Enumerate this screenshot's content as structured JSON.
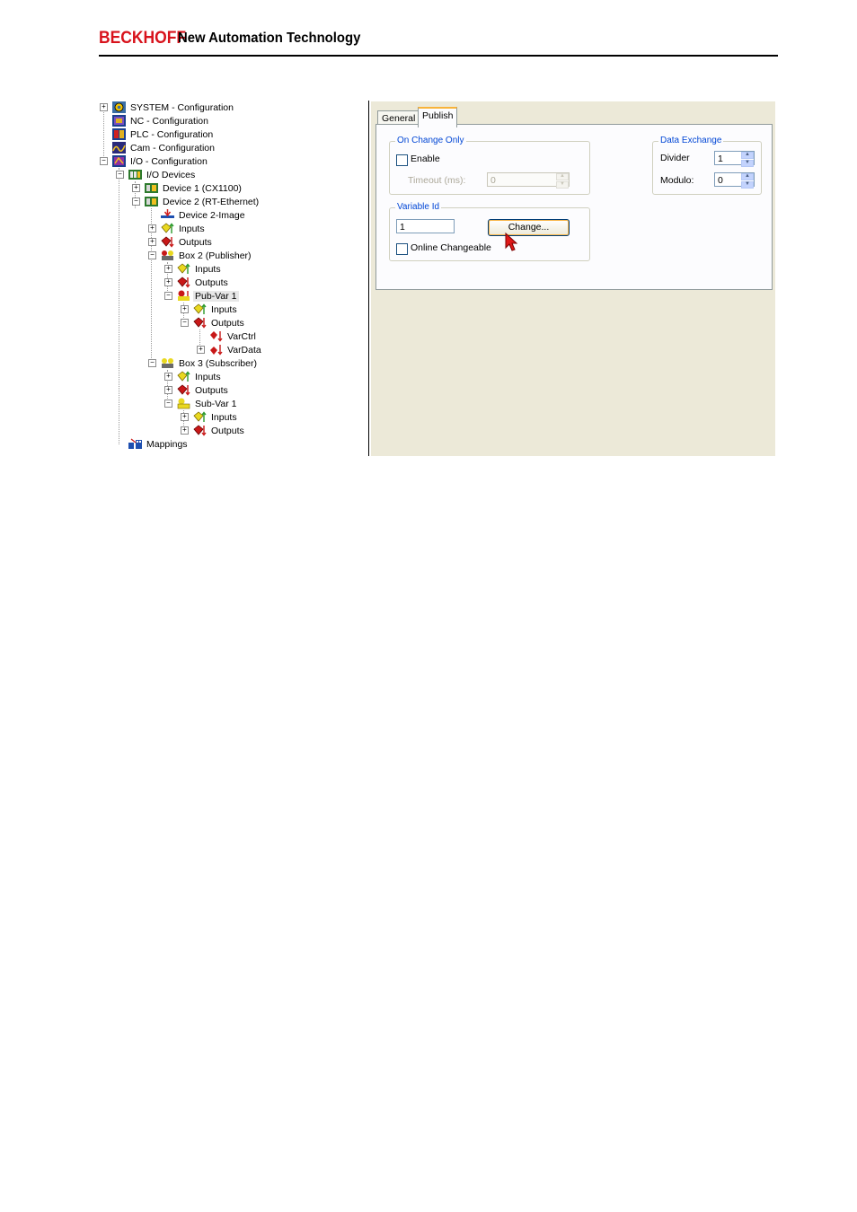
{
  "header": {
    "brand": "BECKHOFF",
    "tagline": "New Automation Technology"
  },
  "tree": [
    {
      "label": "SYSTEM - Configuration",
      "icon": "system-config-icon"
    },
    {
      "label": "NC - Configuration",
      "icon": "nc-config-icon"
    },
    {
      "label": "PLC - Configuration",
      "icon": "plc-config-icon"
    },
    {
      "label": "Cam - Configuration",
      "icon": "cam-config-icon"
    },
    {
      "label": "I/O - Configuration",
      "icon": "io-config-icon"
    },
    {
      "label": "I/O Devices",
      "icon": "io-devices-icon"
    },
    {
      "label": "Device 1 (CX1100)",
      "icon": "device-icon"
    },
    {
      "label": "Device 2 (RT-Ethernet)",
      "icon": "device-icon"
    },
    {
      "label": "Device 2-Image",
      "icon": "image-icon"
    },
    {
      "label": "Inputs",
      "icon": "inputs-icon"
    },
    {
      "label": "Outputs",
      "icon": "outputs-icon"
    },
    {
      "label": "Box 2 (Publisher)",
      "icon": "box-icon"
    },
    {
      "label": "Inputs",
      "icon": "inputs-icon"
    },
    {
      "label": "Outputs",
      "icon": "outputs-icon"
    },
    {
      "label": "Pub-Var 1",
      "icon": "pub-var-icon"
    },
    {
      "label": "Inputs",
      "icon": "inputs-icon"
    },
    {
      "label": "Outputs",
      "icon": "outputs-icon"
    },
    {
      "label": "VarCtrl",
      "icon": "var-output-icon"
    },
    {
      "label": "VarData",
      "icon": "var-output-icon"
    },
    {
      "label": "Box 3 (Subscriber)",
      "icon": "box-icon"
    },
    {
      "label": "Inputs",
      "icon": "inputs-icon"
    },
    {
      "label": "Outputs",
      "icon": "outputs-icon"
    },
    {
      "label": "Sub-Var 1",
      "icon": "sub-var-icon"
    },
    {
      "label": "Inputs",
      "icon": "inputs-icon"
    },
    {
      "label": "Outputs",
      "icon": "outputs-icon"
    },
    {
      "label": "Mappings",
      "icon": "mappings-icon"
    }
  ],
  "tabs": {
    "general": "General",
    "publish": "Publish"
  },
  "on_change_only": {
    "title": "On Change Only",
    "enable_label": "Enable",
    "timeout_label": "Timeout (ms):",
    "timeout_value": "0"
  },
  "variable_id": {
    "title": "Variable Id",
    "value": "1",
    "change_button": "Change...",
    "online_changeable_label": "Online Changeable"
  },
  "data_exchange": {
    "title": "Data Exchange",
    "divider_label": "Divider",
    "divider_value": "1",
    "modulo_label": "Modulo:",
    "modulo_value": "0"
  },
  "colors": {
    "brand_red": "#d8121b",
    "group_title_blue": "#0046d5",
    "dialog_bg": "#ece9d8",
    "tab_accent": "#f8b33a"
  }
}
